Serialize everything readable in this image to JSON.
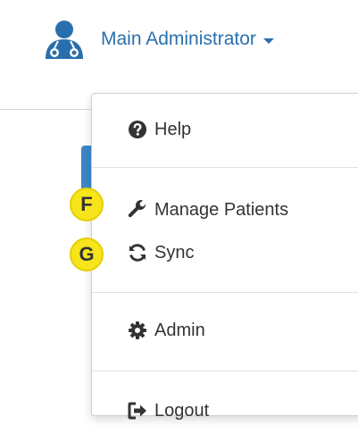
{
  "user_menu": {
    "name": "Main Administrator",
    "icon": "user-doctor-icon"
  },
  "dropdown": {
    "items": [
      {
        "label": "Help",
        "icon": "question-circle-icon"
      },
      {
        "label": "Manage Patients",
        "icon": "wrench-icon"
      },
      {
        "label": "Sync",
        "icon": "refresh-icon"
      },
      {
        "label": "Admin",
        "icon": "gear-icon"
      },
      {
        "label": "Logout",
        "icon": "sign-out-icon"
      }
    ]
  },
  "badges": {
    "f": "F",
    "g": "G"
  },
  "colors": {
    "link": "#2a6fad",
    "text": "#333333",
    "badge": "#f7e41a",
    "accent": "#3a87c8"
  }
}
